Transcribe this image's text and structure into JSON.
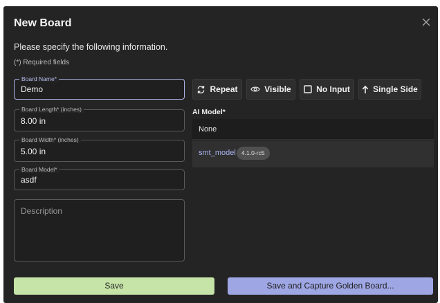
{
  "dialog": {
    "title": "New Board",
    "subtitle": "Please specify the following information.",
    "required_note": "(*) Required fields",
    "close_icon": "close-icon"
  },
  "form": {
    "board_name": {
      "label": "Board Name*",
      "value": "Demo"
    },
    "board_length": {
      "label": "Board Length* (inches)",
      "value": "8.00 in"
    },
    "board_width": {
      "label": "Board Width* (inches)",
      "value": "5.00 in"
    },
    "board_model": {
      "label": "Board Model*",
      "value": "asdf"
    },
    "description": {
      "placeholder": "Description",
      "value": ""
    }
  },
  "toggles": {
    "repeat": {
      "label": "Repeat",
      "icon": "repeat-icon"
    },
    "visible": {
      "label": "Visible",
      "icon": "eye-icon"
    },
    "no_input": {
      "label": "No Input",
      "icon": "checkbox-empty-icon"
    },
    "single_side": {
      "label": "Single Side",
      "icon": "arrow-up-icon"
    }
  },
  "ai_model": {
    "label": "AI Model*",
    "none_option": "None",
    "models": [
      {
        "name": "smt_model",
        "version": "4.1.0-rc5",
        "selected": true
      }
    ]
  },
  "actions": {
    "save_label": "Save",
    "save_golden_label": "Save and Capture Golden Board..."
  },
  "colors": {
    "dialog_bg": "#242424",
    "accent": "#aeb6e6",
    "save_button": "#c6e4a7",
    "golden_button": "#9ea6e4"
  }
}
